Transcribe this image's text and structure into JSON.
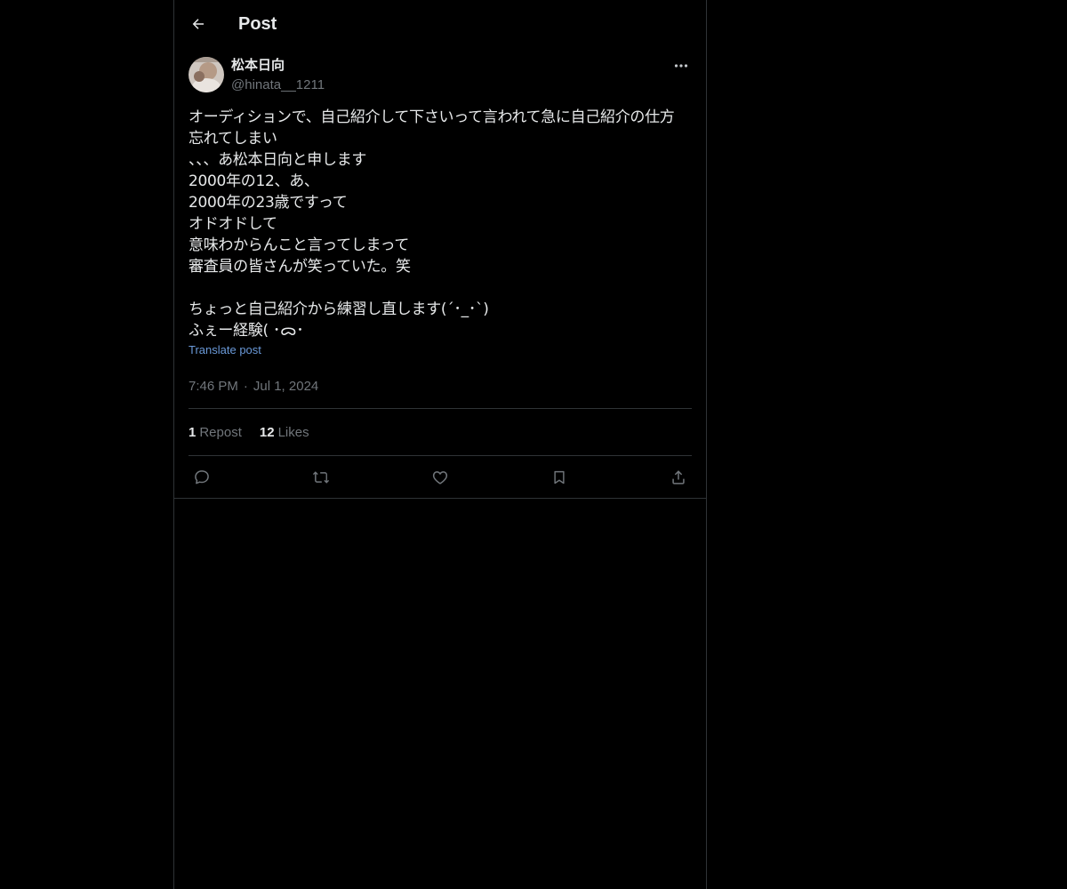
{
  "header": {
    "title": "Post",
    "back_icon": "arrow-left-icon"
  },
  "post": {
    "author": {
      "name": "松本日向",
      "handle": "@hinata__1211",
      "avatar_icon": "avatar-photo"
    },
    "more_icon": "ellipsis-icon",
    "text": "オーディションで、自己紹介して下さいって言われて急に自己紹介の仕方\n忘れてしまい\n、、、あ松本日向と申します\n2000年の12、あ、\n2000年の23歳ですって\nオドオドして\n意味わからんこと言ってしまって\n審査員の皆さんが笑っていた。笑\n\nちょっと自己紹介から練習し直します(´･_･`)\nふぇー経験( ･ᯅ･",
    "translate_label": "Translate post",
    "time": "7:46 PM",
    "separator": "·",
    "date": "Jul 1, 2024",
    "stats": {
      "reposts_count": "1",
      "reposts_label": "Repost",
      "likes_count": "12",
      "likes_label": "Likes"
    },
    "actions": [
      "reply-icon",
      "repost-icon",
      "like-icon",
      "bookmark-icon",
      "share-icon"
    ]
  },
  "colors": {
    "background": "#000000",
    "text_primary": "#e7e9ea",
    "text_secondary": "#71767b",
    "border": "#2f3336",
    "link": "#6a99d8"
  }
}
